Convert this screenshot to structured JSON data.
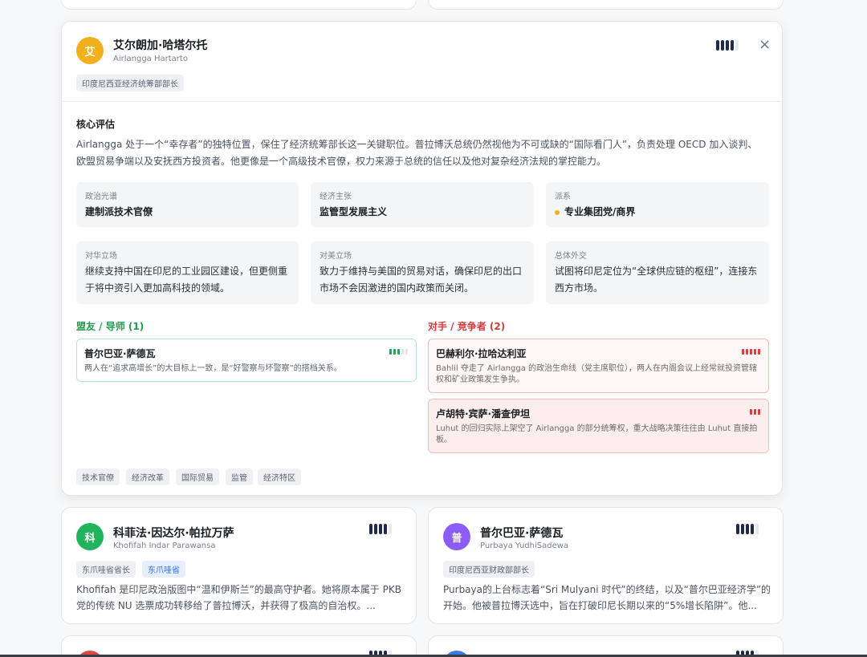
{
  "main": {
    "initial": "艾",
    "name_cn": "艾尔朗加·哈塔尔托",
    "name_en": "Airlangga Hartarto",
    "role": "印度尼西亚经济统筹部部长",
    "close_glyph": "×",
    "section_title": "核心评估",
    "summary_line1": "Airlangga 处于一个“幸存者”的独特位置，保住了经济统筹部长这一关键职位。普拉博沃总统仍然视他为不可或缺的“国际看门人”，负责处理 OECD 加入谈判、",
    "summary_line2": "欧盟贸易争端以及安抚西方投资者。他更像是一个高级技术官僚，权力来源于总统的信任以及他对复杂经济法规的掌控能力。",
    "cells": [
      {
        "label": "政治光谱",
        "value": "建制派技术官僚"
      },
      {
        "label": "经济主张",
        "value": "监管型发展主义"
      },
      {
        "label": "派系",
        "value": "专业集团党/商界"
      },
      {
        "label": "对华立场",
        "value": "继续支持中国在印尼的工业园区建设，但更侧重于将中资引入更加高科技的领域。"
      },
      {
        "label": "对美立场",
        "value": "致力于维持与美国的贸易对话，确保印尼的出口市场不会因激进的国内政策而关闭。"
      },
      {
        "label": "总体外交",
        "value": "试图将印尼定位为“全球供应链的枢纽”，连接东西方市场。"
      }
    ],
    "allies_title": "盟友 / 导师 (1)",
    "allies": [
      {
        "name": "普尔巴亚·萨德瓦",
        "desc": "两人在“追求高增长”的大目标上一致，是“好警察与坏警察”的搭档关系。"
      }
    ],
    "rivals_title": "对手 / 竞争者 (2)",
    "rivals": [
      {
        "name": "巴赫利尔·拉哈达利亚",
        "desc": "Bahlil 夺走了 Airlangga 的政治生命线（党主席职位），两人在内阁会议上经常就投资管辖权和矿业政策发生争执。"
      },
      {
        "name": "卢胡特·宾萨·潘查伊坦",
        "desc": "Luhut 的回归实际上架空了 Airlangga 的部分统筹权，重大战略决策往往由 Luhut 直接拍板。"
      }
    ],
    "tags": [
      "技术官僚",
      "经济改革",
      "国际贸易",
      "监管",
      "经济特区"
    ],
    "accent_color": "#f2b01e"
  },
  "cards": [
    {
      "initial": "科",
      "name_cn": "科菲法·因达尔·帕拉万萨",
      "name_en": "Khofifah Indar Parawansa",
      "roles": [
        "东爪哇省省长",
        "东爪哇省"
      ],
      "summary": "Khofifah 是印尼政治版图中“温和伊斯兰”的最高守护者。她将原本属于 PKB 党的传统 NU 选票成功转移给了普拉博沃，并获得了极高的自治权。...",
      "avatar_color": "#22b45c"
    },
    {
      "initial": "普",
      "name_cn": "普尔巴亚·萨德瓦",
      "name_en": "Purbaya YudhiSadewa",
      "roles": [
        "印度尼西亚财政部部长"
      ],
      "summary": "Purbaya的上台标志着“Sri Mulyani 时代”的终结，以及“普尔巴亚经济学”的开始。他被普拉博沃选中，旨在打破印尼长期以来的“5%增长陷阱”。他...",
      "avatar_color": "#8b5cf6"
    }
  ]
}
